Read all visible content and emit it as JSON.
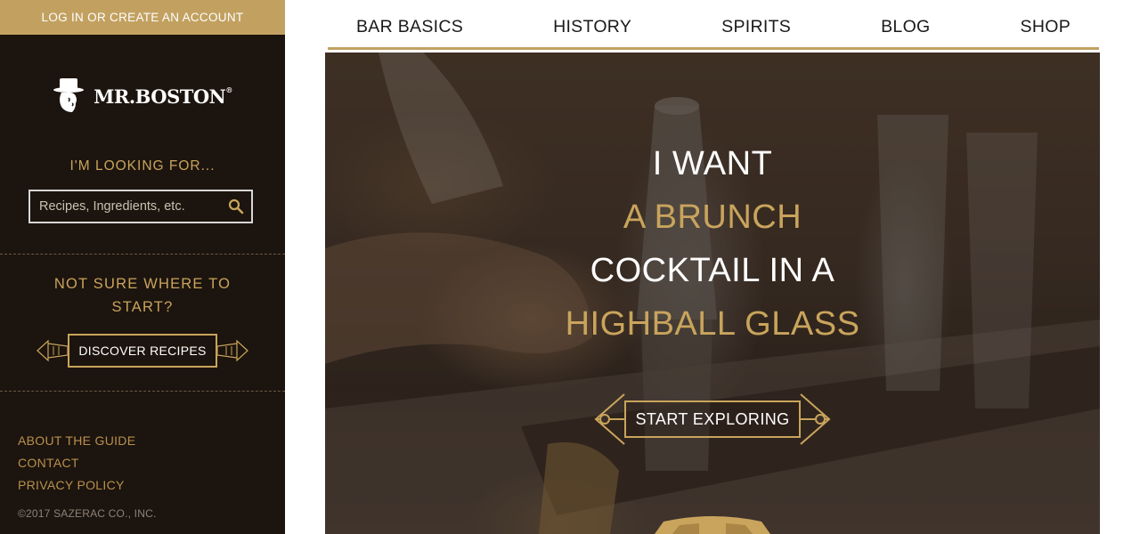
{
  "sidebar": {
    "login_label": "LOG IN OR CREATE AN ACCOUNT",
    "brand_name": "MR.BOSTON",
    "brand_mark": "®",
    "looking_label": "I'M LOOKING FOR...",
    "search_placeholder": "Recipes, Ingredients, etc.",
    "search_icon": "search-icon",
    "not_sure_line1": "NOT SURE WHERE TO",
    "not_sure_line2": "START?",
    "discover_label": "DISCOVER RECIPES",
    "footer_links": [
      "ABOUT THE GUIDE",
      "CONTACT",
      "PRIVACY POLICY"
    ],
    "copyright": "©2017 SAZERAC CO., INC."
  },
  "nav": {
    "items": [
      "BAR BASICS",
      "HISTORY",
      "SPIRITS",
      "BLOG",
      "SHOP"
    ]
  },
  "hero": {
    "line1": "I WANT",
    "line2": "A BRUNCH",
    "line3": "COCKTAIL IN A",
    "line4": "HIGHBALL GLASS",
    "cta_label": "START EXPLORING"
  },
  "colors": {
    "sidebar_bg": "#1c140e",
    "gold": "#c9a45c",
    "login_bar": "#c2a160",
    "white": "#ffffff"
  }
}
